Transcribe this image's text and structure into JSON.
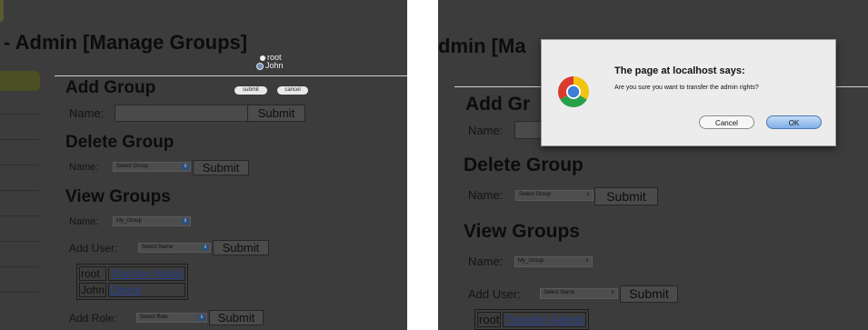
{
  "left": {
    "title": "- Admin [Manage Groups]",
    "users": [
      "root",
      "John"
    ],
    "submit_pill": "submit",
    "cancel_pill": "cancel",
    "add_group": {
      "heading": "Add Group",
      "name_label": "Name:",
      "submit": "Submit"
    },
    "delete_group": {
      "heading": "Delete Group",
      "name_label": "Name:",
      "select_value": "Select Group",
      "submit": "Submit"
    },
    "view_groups": {
      "heading": "View Groups",
      "name_label": "Name:",
      "select_value": "My_Group",
      "add_user_label": "Add User:",
      "add_user_select": "Select Name",
      "add_user_submit": "Submit",
      "members": [
        {
          "name": "root",
          "action": "Transfer Admin"
        },
        {
          "name": "John",
          "action": "Delete"
        }
      ],
      "add_role_label": "Add Role:",
      "add_role_select": "Select Role",
      "add_role_submit": "Submit"
    }
  },
  "right": {
    "title": "dmin [Ma",
    "add_group": {
      "heading": "Add Gr",
      "name_label": "Name:"
    },
    "delete_group": {
      "heading": "Delete Group",
      "name_label": "Name:",
      "select_value": "Select Group",
      "submit": "Submit"
    },
    "view_groups": {
      "heading": "View Groups",
      "name_label": "Name:",
      "select_value": "My_Group",
      "add_user_label": "Add User:",
      "add_user_select": "Select Name",
      "add_user_submit": "Submit",
      "members": [
        {
          "name": "root",
          "action": "Transfer Admin"
        }
      ]
    }
  },
  "dialog": {
    "title": "The page at localhost says:",
    "message": "Are you sure you want to transfer the admin rights?",
    "cancel": "Cancel",
    "ok": "OK"
  },
  "colors": {
    "overlay": "#3c3c3c",
    "link": "#283f8c",
    "ok_button": "#8ab6ec"
  },
  "icons": {
    "browser_logo": "chrome-logo-icon",
    "dropdown": "chevron-updown-icon"
  }
}
